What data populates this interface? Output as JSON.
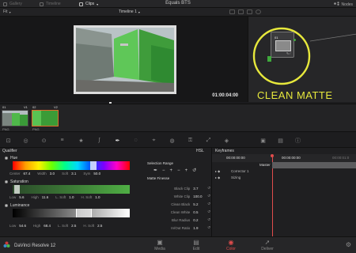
{
  "app": {
    "name": "DaVinci Resolve 12",
    "project_title": "Equals BTS"
  },
  "topbar": {
    "tabs": [
      {
        "label": "Gallery",
        "icon": "gallery-icon"
      },
      {
        "label": "Timeline",
        "icon": "timeline-icon"
      },
      {
        "label": "Clips",
        "icon": "clips-icon"
      }
    ],
    "nodes_label": "Nodes"
  },
  "viewer_bar": {
    "fit_label": "Fit",
    "timeline_label": "Timeline 1"
  },
  "viewer": {
    "timecode": "01:00:04:00"
  },
  "nodegraph": {
    "node_label": "01"
  },
  "annotation": {
    "text": "CLEAN MATTE",
    "color": "#e7e83c"
  },
  "clips": [
    {
      "label": "01",
      "track": "V1",
      "format": "PNG"
    },
    {
      "label": "02",
      "track": "V2",
      "format": "PNG"
    }
  ],
  "qualifier": {
    "title": "Qualifier",
    "mode": "HSL",
    "hue": {
      "label": "Hue",
      "values": [
        {
          "name": "Center",
          "value": "67.4"
        },
        {
          "name": "Width",
          "value": "3.0"
        },
        {
          "name": "Soft",
          "value": "3.1"
        },
        {
          "name": "Sym",
          "value": "50.0"
        }
      ]
    },
    "saturation": {
      "label": "Saturation",
      "values": [
        {
          "name": "Low",
          "value": "5.6"
        },
        {
          "name": "High",
          "value": "11.6"
        },
        {
          "name": "L. Soft",
          "value": "1.0"
        },
        {
          "name": "H. Soft",
          "value": "1.0"
        }
      ]
    },
    "luminance": {
      "label": "Luminance",
      "values": [
        {
          "name": "Low",
          "value": "54.6"
        },
        {
          "name": "High",
          "value": "68.4"
        },
        {
          "name": "L. Soft",
          "value": "2.5"
        },
        {
          "name": "H. Soft",
          "value": "2.5"
        }
      ]
    },
    "selection_range_label": "Selection Range",
    "matte_finesse_label": "Matte Finesse",
    "matte_finesse": [
      {
        "name": "Black Clip",
        "value": "3.7"
      },
      {
        "name": "White Clip",
        "value": "100.0"
      },
      {
        "name": "Clean Black",
        "value": "5.2"
      },
      {
        "name": "Clean White",
        "value": "0.5"
      },
      {
        "name": "Blur Radius",
        "value": "0.2"
      },
      {
        "name": "In/Out Ratio",
        "value": "1.9"
      }
    ]
  },
  "keyframes": {
    "title": "Keyframes",
    "timecode_left": "00:00:00:00",
    "timecode_mid": "00:00:00:00",
    "timecode_right": "00:00:01:0",
    "rows": [
      {
        "label": "Master"
      },
      {
        "label": "Corrector 1"
      },
      {
        "label": "Sizing"
      }
    ]
  },
  "bottom_nav": {
    "items": [
      {
        "label": "Media",
        "icon": "media-icon"
      },
      {
        "label": "Edit",
        "icon": "edit-icon"
      },
      {
        "label": "Color",
        "icon": "color-icon",
        "active": true
      },
      {
        "label": "Deliver",
        "icon": "deliver-icon"
      }
    ]
  }
}
